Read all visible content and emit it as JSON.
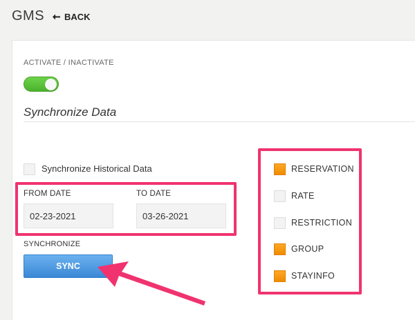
{
  "header": {
    "app_title": "GMS",
    "back_label": "BACK"
  },
  "settings": {
    "activate_label": "ACTIVATE / INACTIVATE",
    "activate_on": true,
    "section_title": "Synchronize Data"
  },
  "sync_form": {
    "historical_label": "Synchronize Historical Data",
    "historical_checked": false,
    "from_label": "FROM DATE",
    "from_value": "02-23-2021",
    "to_label": "TO DATE",
    "to_value": "03-26-2021",
    "synchronize_label": "SYNCHRONIZE",
    "sync_button": "SYNC"
  },
  "options": [
    {
      "label": "RESERVATION",
      "checked": true
    },
    {
      "label": "RATE",
      "checked": false
    },
    {
      "label": "RESTRICTION",
      "checked": false
    },
    {
      "label": "GROUP",
      "checked": true
    },
    {
      "label": "STAYINFO",
      "checked": true
    }
  ],
  "colors": {
    "highlight": "#f0336f",
    "checked": "#f5960d",
    "toggle_on": "#5cc33a",
    "sync_button": "#4a97e0"
  },
  "icons": {
    "back": "arrow-left-icon",
    "annotation": "annotation-arrow"
  }
}
